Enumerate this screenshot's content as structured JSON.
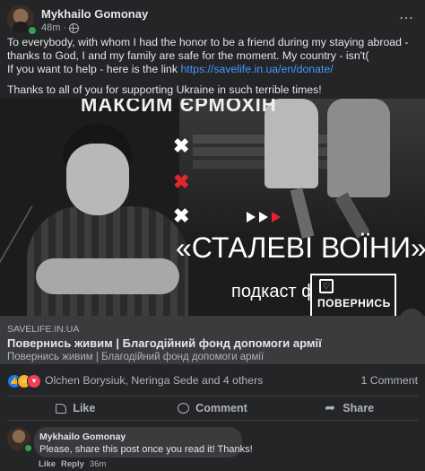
{
  "post": {
    "author": "Mykhailo Gomonay",
    "time": "48m",
    "more_icon": "⋯",
    "text_line1": "To everybody, with whom I had the honor to be a friend during my staying abroad - thanks to God, I and my family are safe for the moment. My country  - isn't(",
    "text_help_prefix": "If you want to help - here is the link ",
    "text_link": "https://savelife.in.ua/en/donate/",
    "text_line2": "Thanks to all of you for supporting Ukraine in such terrible times!"
  },
  "banner": {
    "person_name": "МАКСИМ ЄРМОХІН",
    "title": "«СТАЛЕВІ ВОЇНИ»",
    "subtitle": "подкаст фонду",
    "badge_text": "ПОВЕРНИСЬ",
    "x_marks": [
      "✖",
      "✖",
      "✖"
    ],
    "accent_red": "#e4252e"
  },
  "link_preview": {
    "domain": "SAVELIFE.IN.UA",
    "title": "Повернись живим | Благодійний фонд допомоги армії",
    "description": "Повернись живим | Благодійний фонд допомоги армії"
  },
  "reactions": {
    "icons": [
      "like",
      "care",
      "love"
    ],
    "names": "Olchen Borysiuk, Neringa Sede and 4 others",
    "comments": "1 Comment"
  },
  "actions": {
    "like": "Like",
    "comment": "Comment",
    "share": "Share"
  },
  "comment": {
    "author": "Mykhailo Gomonay",
    "text": "Please, share this post once you read it! Thanks!",
    "like": "Like",
    "reply": "Reply",
    "time": "36m"
  }
}
